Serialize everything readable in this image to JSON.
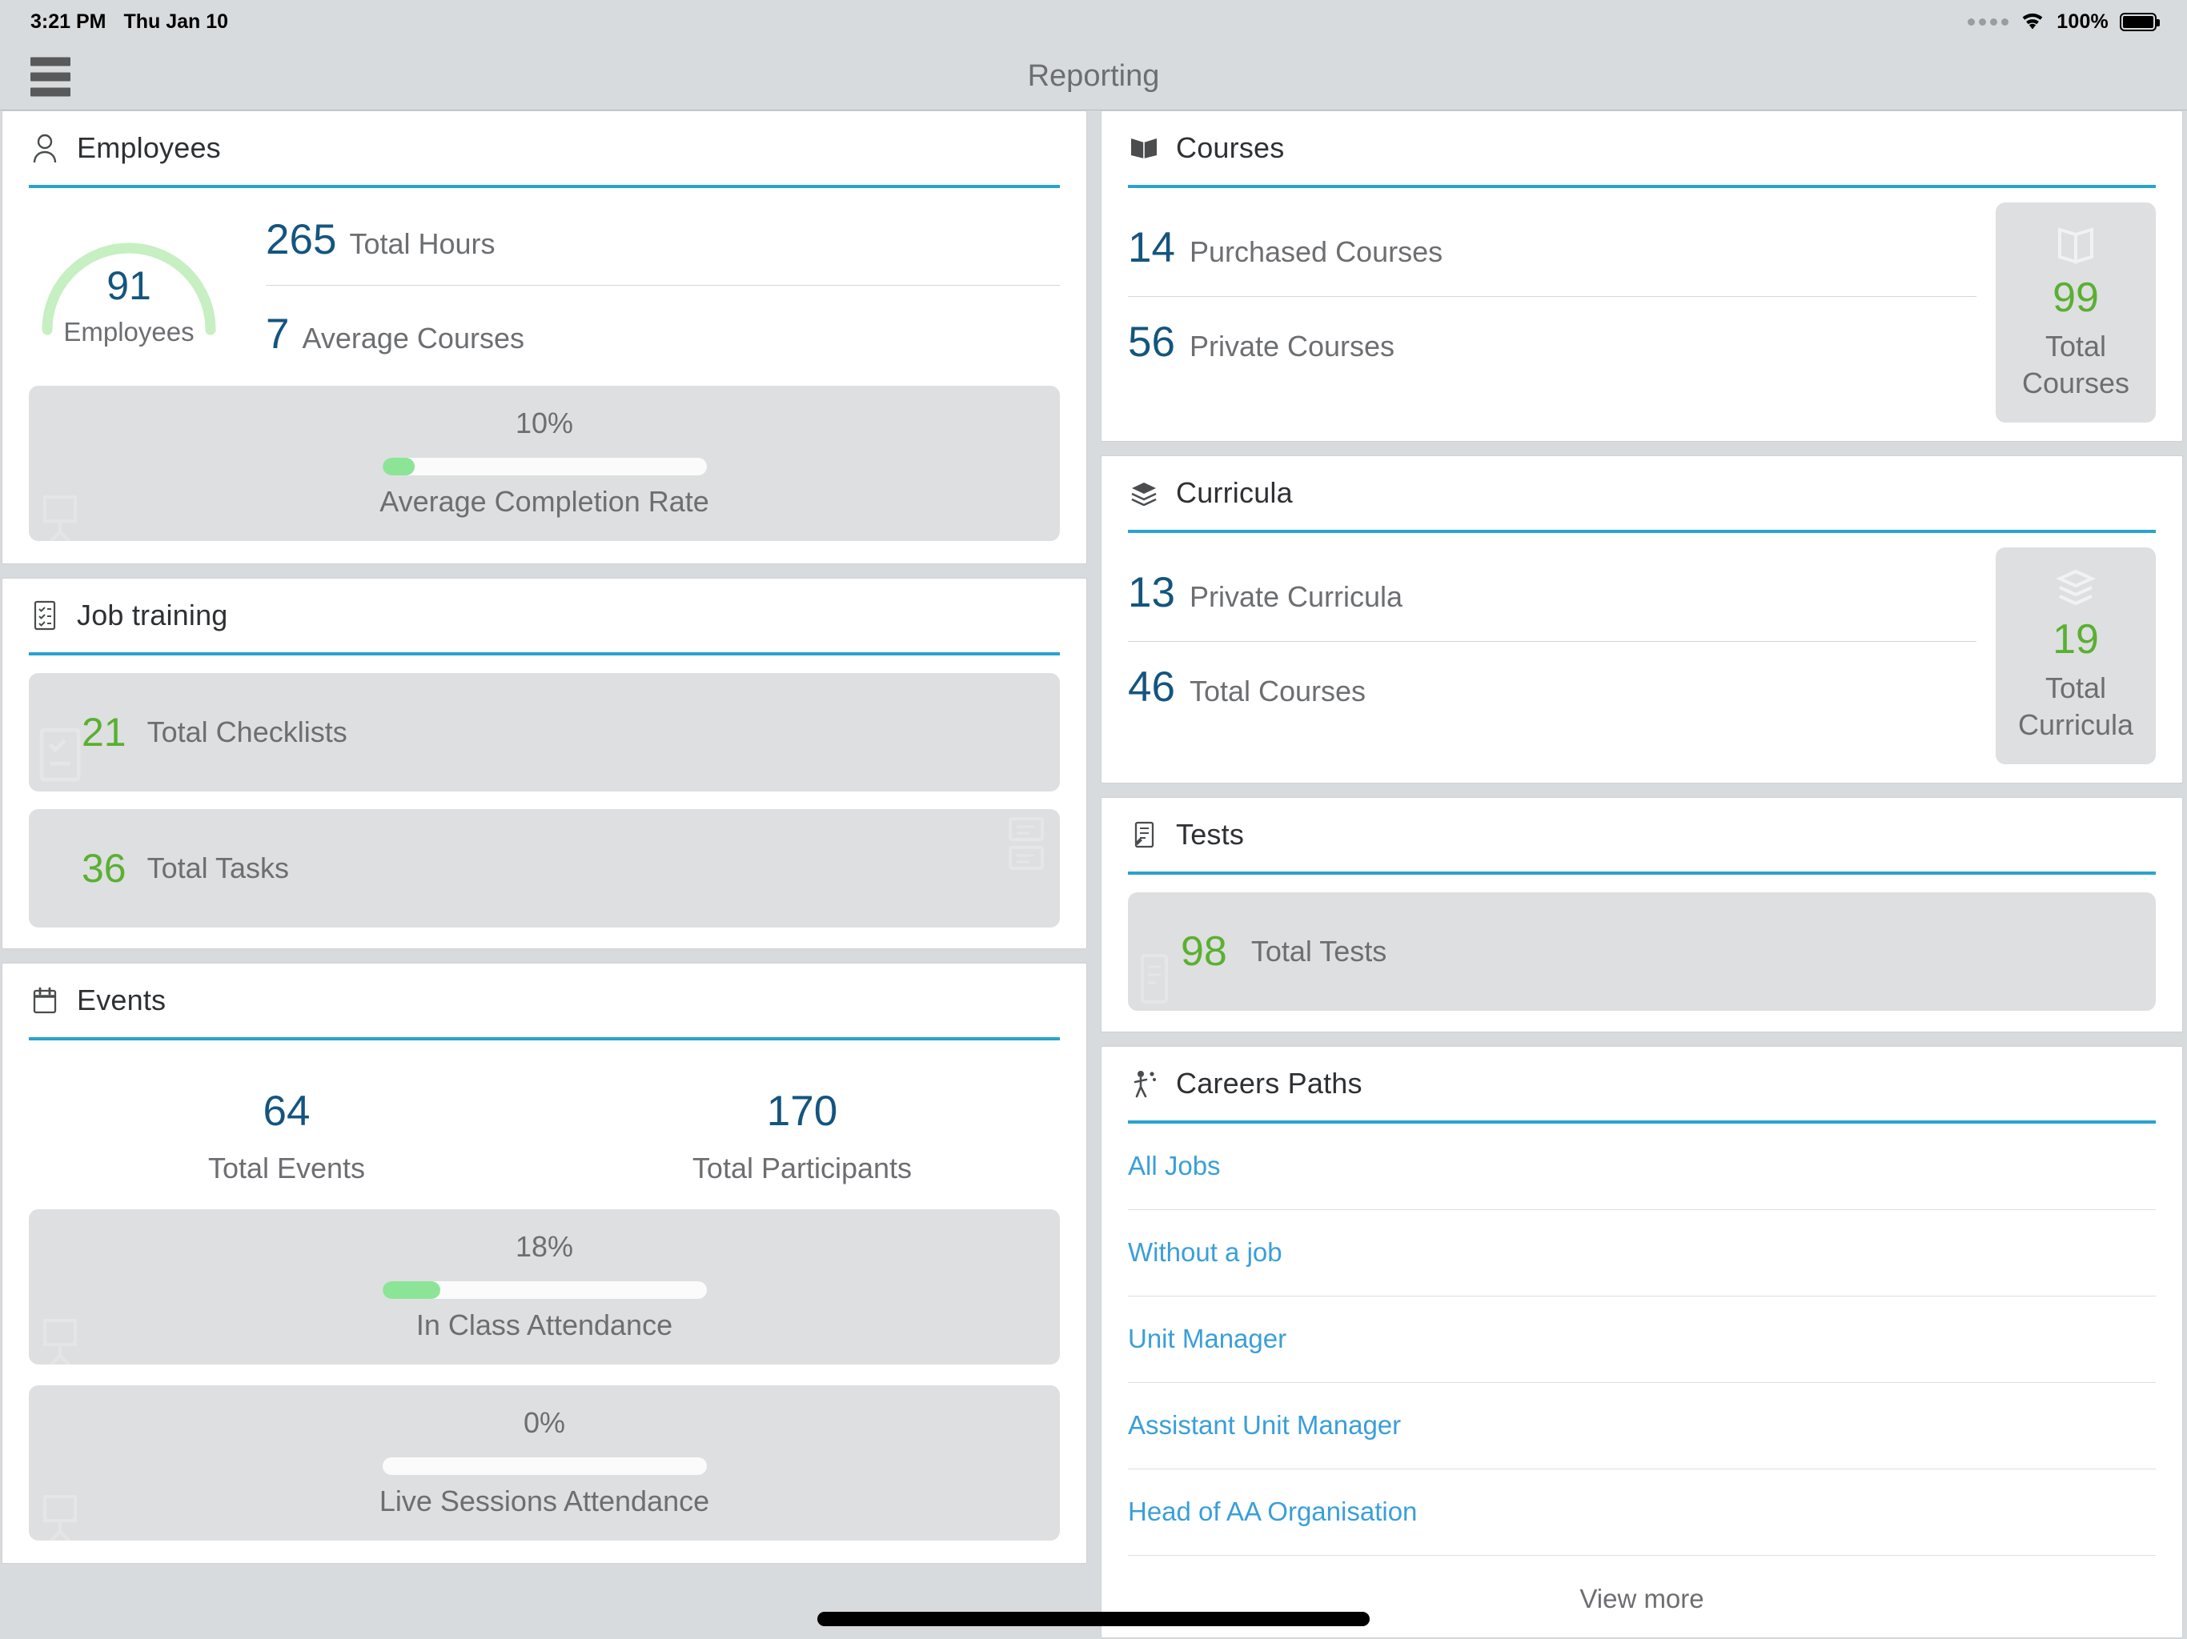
{
  "statusbar": {
    "time": "3:21 PM",
    "date": "Thu Jan 10",
    "battery_pct": "100%",
    "signal_icon": "signal-dots-icon",
    "wifi_icon": "wifi-icon",
    "battery_icon": "battery-full-icon"
  },
  "navbar": {
    "title": "Reporting",
    "menu_icon": "hamburger-menu-icon"
  },
  "employees": {
    "title": "Employees",
    "icon": "person-icon",
    "gauge_value": "91",
    "gauge_label": "Employees",
    "gauge_percent": 91,
    "rows": [
      {
        "value": "265",
        "label": "Total Hours"
      },
      {
        "value": "7",
        "label": "Average Courses"
      }
    ],
    "progress": {
      "pct_text": "10%",
      "pct_value": 10,
      "caption": "Average Completion Rate"
    }
  },
  "job_training": {
    "title": "Job training",
    "icon": "checklist-icon",
    "tiles": [
      {
        "value": "21",
        "label": "Total Checklists",
        "watermark": "checklist-watermark-icon"
      },
      {
        "value": "36",
        "label": "Total Tasks",
        "watermark": "tasks-watermark-icon"
      }
    ]
  },
  "events": {
    "title": "Events",
    "icon": "calendar-icon",
    "stats": [
      {
        "value": "64",
        "label": "Total Events"
      },
      {
        "value": "170",
        "label": "Total Participants"
      }
    ],
    "bars": [
      {
        "pct_text": "18%",
        "pct_value": 18,
        "caption": "In Class Attendance",
        "watermark": "presentation-watermark-icon"
      },
      {
        "pct_text": "0%",
        "pct_value": 0,
        "caption": "Live Sessions Attendance",
        "watermark": "presentation-watermark-icon"
      }
    ]
  },
  "courses": {
    "title": "Courses",
    "icon": "book-open-icon",
    "rows": [
      {
        "value": "14",
        "label": "Purchased Courses"
      },
      {
        "value": "56",
        "label": "Private Courses"
      }
    ],
    "total": {
      "value": "99",
      "label_line1": "Total",
      "label_line2": "Courses",
      "watermark": "book-watermark-icon"
    }
  },
  "curricula": {
    "title": "Curricula",
    "icon": "layers-icon",
    "rows": [
      {
        "value": "13",
        "label": "Private Curricula"
      },
      {
        "value": "46",
        "label": "Total Courses"
      }
    ],
    "total": {
      "value": "19",
      "label_line1": "Total",
      "label_line2": "Curricula",
      "watermark": "layers-watermark-icon"
    }
  },
  "tests": {
    "title": "Tests",
    "icon": "test-paper-icon",
    "tile": {
      "value": "98",
      "label": "Total Tests",
      "watermark": "test-watermark-icon"
    }
  },
  "careers_paths": {
    "title": "Careers Paths",
    "icon": "career-path-icon",
    "items": [
      {
        "label": "All Jobs"
      },
      {
        "label": "Without a job"
      },
      {
        "label": "Unit Manager"
      },
      {
        "label": "Assistant Unit Manager"
      },
      {
        "label": "Head of AA Organisation"
      }
    ],
    "view_more": "View more"
  },
  "colors": {
    "accent_blue": "#29a3cd",
    "link_blue": "#3a9fd8",
    "number_blue": "#14557f",
    "number_green": "#5ab031",
    "progress_green": "#8ce596",
    "page_bg": "#d8dbdd",
    "tile_bg": "#dedfe1",
    "label_grey": "#6d6e71"
  }
}
